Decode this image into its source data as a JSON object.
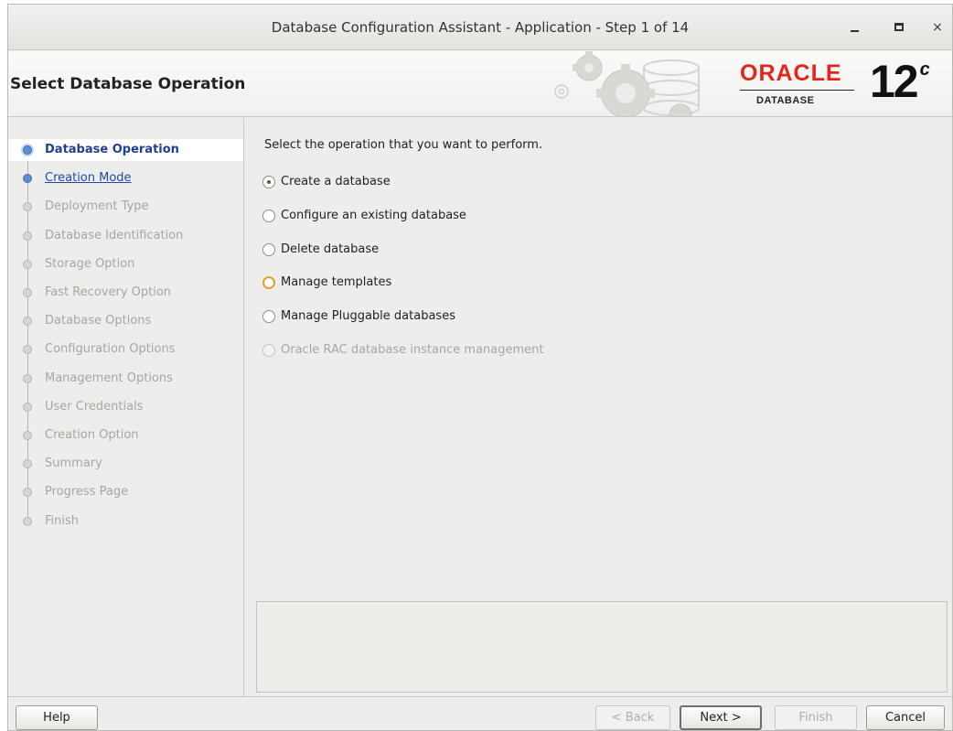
{
  "window": {
    "title": "Database Configuration Assistant - Application - Step 1 of 14",
    "minimize_glyph": "minimize-icon",
    "maximize_glyph": "maximize-icon",
    "close_glyph": "×"
  },
  "banner": {
    "heading": "Select Database Operation",
    "logo_word": "ORACLE",
    "logo_sub": "DATABASE",
    "version": "12",
    "version_sup": "c"
  },
  "steps": [
    {
      "label": "Database Operation",
      "state": "active"
    },
    {
      "label": "Creation Mode",
      "state": "link"
    },
    {
      "label": "Deployment Type",
      "state": "disabled"
    },
    {
      "label": "Database Identification",
      "state": "disabled"
    },
    {
      "label": "Storage Option",
      "state": "disabled"
    },
    {
      "label": "Fast Recovery Option",
      "state": "disabled"
    },
    {
      "label": "Database Options",
      "state": "disabled"
    },
    {
      "label": "Configuration Options",
      "state": "disabled"
    },
    {
      "label": "Management Options",
      "state": "disabled"
    },
    {
      "label": "User Credentials",
      "state": "disabled"
    },
    {
      "label": "Creation Option",
      "state": "disabled"
    },
    {
      "label": "Summary",
      "state": "disabled"
    },
    {
      "label": "Progress Page",
      "state": "disabled"
    },
    {
      "label": "Finish",
      "state": "disabled"
    }
  ],
  "main": {
    "prompt": "Select the operation that you want to perform.",
    "options": [
      {
        "label": "Create a database",
        "selected": true,
        "enabled": true,
        "focused": false
      },
      {
        "label": "Configure an existing database",
        "selected": false,
        "enabled": true,
        "focused": false
      },
      {
        "label": "Delete database",
        "selected": false,
        "enabled": true,
        "focused": false
      },
      {
        "label": "Manage templates",
        "selected": false,
        "enabled": true,
        "focused": true
      },
      {
        "label": "Manage Pluggable databases",
        "selected": false,
        "enabled": true,
        "focused": false
      },
      {
        "label": "Oracle RAC database instance management",
        "selected": false,
        "enabled": false,
        "focused": false
      }
    ]
  },
  "buttons": {
    "help": "Help",
    "back": "< Back",
    "next": "Next >",
    "finish": "Finish",
    "cancel": "Cancel"
  },
  "colors": {
    "oracle_red": "#e3261b",
    "active_step": "#1f3f8f",
    "link_step": "#2448a6"
  }
}
